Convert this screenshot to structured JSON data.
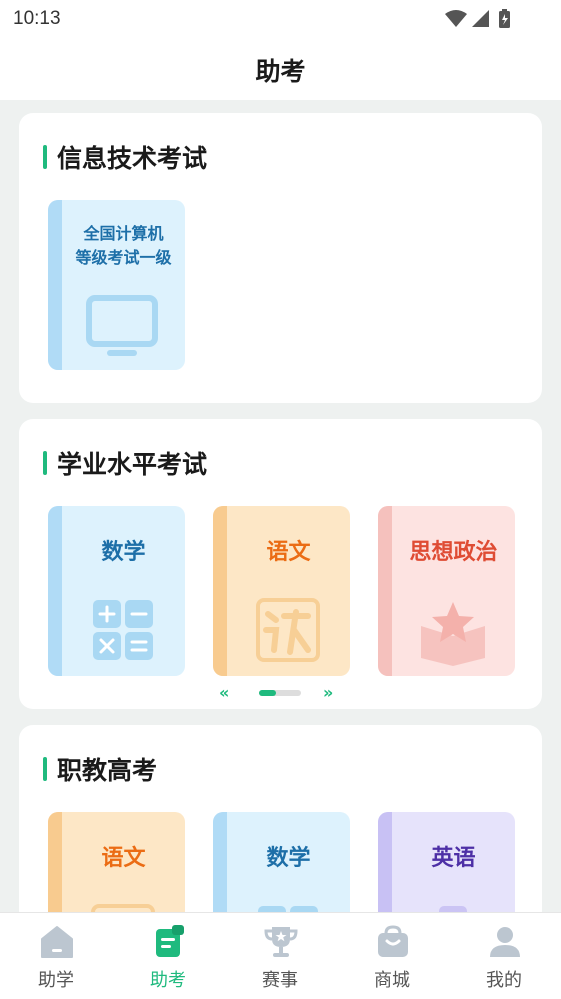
{
  "status_bar": {
    "time": "10:13"
  },
  "header": {
    "title": "助考"
  },
  "sections": [
    {
      "title": "信息技术考试",
      "books": [
        {
          "title": "全国计算机等级考试一级",
          "title_lines": [
            "全国计算机",
            "等级考试一级"
          ],
          "icon": "monitor-icon",
          "theme": "blue"
        }
      ]
    },
    {
      "title": "学业水平考试",
      "books": [
        {
          "title": "数学",
          "icon": "calculator-icon",
          "theme": "blue"
        },
        {
          "title": "语文",
          "icon": "chinese-character-icon",
          "theme": "orange"
        },
        {
          "title": "思想政治",
          "icon": "star-book-icon",
          "theme": "pink"
        }
      ],
      "pager": {
        "left_arrow": "«",
        "right_arrow": "»",
        "progress": 0.4
      }
    },
    {
      "title": "职教高考",
      "books": [
        {
          "title": "语文",
          "icon": "chinese-character-icon",
          "theme": "orange"
        },
        {
          "title": "数学",
          "icon": "calculator-icon",
          "theme": "blue"
        },
        {
          "title": "英语",
          "icon": "english-icon",
          "theme": "purple"
        }
      ]
    }
  ],
  "tabbar": {
    "items": [
      {
        "label": "助学",
        "icon": "home-icon",
        "active": false
      },
      {
        "label": "助考",
        "icon": "exam-doc-icon",
        "active": true
      },
      {
        "label": "赛事",
        "icon": "trophy-icon",
        "active": false
      },
      {
        "label": "商城",
        "icon": "shopping-bag-icon",
        "active": false
      },
      {
        "label": "我的",
        "icon": "user-icon",
        "active": false
      }
    ]
  },
  "colors": {
    "accent": "#1fba7e",
    "background": "#eef1f0"
  }
}
